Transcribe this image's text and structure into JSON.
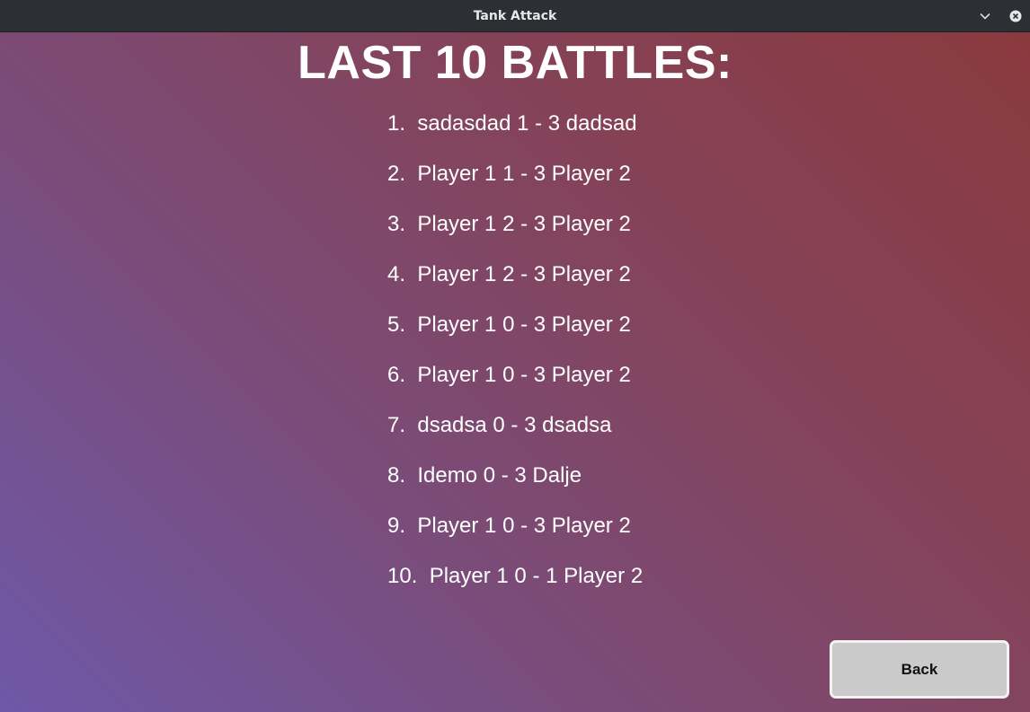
{
  "window": {
    "title": "Tank Attack",
    "minimize_icon": "chevron-down-icon",
    "close_icon": "close-circle-icon"
  },
  "page": {
    "title": "LAST 10 BATTLES:",
    "back_label": "Back",
    "battles": [
      {
        "number": "1.",
        "text": "sadasdad 1 - 3 dadsad"
      },
      {
        "number": "2.",
        "text": "Player 1 1 - 3 Player 2"
      },
      {
        "number": "3.",
        "text": "Player 1 2 - 3 Player 2"
      },
      {
        "number": "4.",
        "text": "Player 1 2 - 3 Player 2"
      },
      {
        "number": "5.",
        "text": "Player 1 0 - 3 Player 2"
      },
      {
        "number": "6.",
        "text": "Player 1 0 - 3 Player 2"
      },
      {
        "number": "7.",
        "text": "dsadsa 0 - 3 dsadsa"
      },
      {
        "number": "8.",
        "text": "Idemo 0 - 3 Dalje"
      },
      {
        "number": "9.",
        "text": "Player 1 0 - 3 Player 2"
      },
      {
        "number": "10.",
        "text": "Player 1 0 - 1 Player 2"
      }
    ]
  },
  "colors": {
    "gradient_top_right": "#8a3a3e",
    "gradient_bottom_left": "#6e58a8",
    "button_bg": "#cacaca"
  }
}
